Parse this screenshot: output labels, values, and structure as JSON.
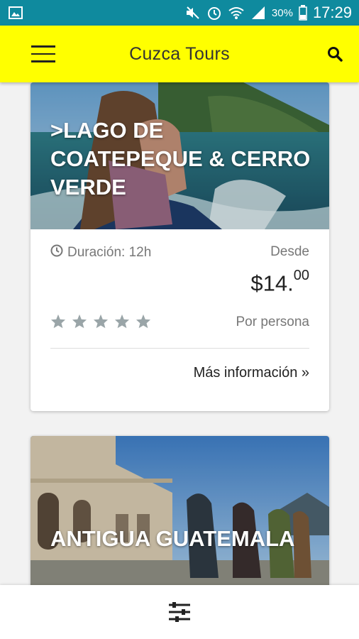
{
  "status_bar": {
    "battery": "30%",
    "time": "17:29",
    "icons": [
      "gallery-icon",
      "mute-icon",
      "alarm-icon",
      "wifi-icon",
      "signal-icon",
      "battery-icon"
    ]
  },
  "app_bar": {
    "title": "Cuzca Tours",
    "icons": [
      "menu-icon",
      "search-icon"
    ]
  },
  "tours": [
    {
      "title": ">LAGO DE COATEPEQUE & CERRO VERDE",
      "duration": "Duración: 12h",
      "from_label": "Desde",
      "price_main": "$14.",
      "price_cents": "00",
      "rating": 0,
      "per_person": "Por persona",
      "more_info": "Más información »"
    },
    {
      "title": "ANTIGUA GUATEMALA"
    }
  ],
  "bottom_bar": {
    "icon": "filter-sliders-icon"
  },
  "colors": {
    "status_bar": "#0f8a9e",
    "app_bar": "#ffff00",
    "star": "#9aa5a8"
  }
}
